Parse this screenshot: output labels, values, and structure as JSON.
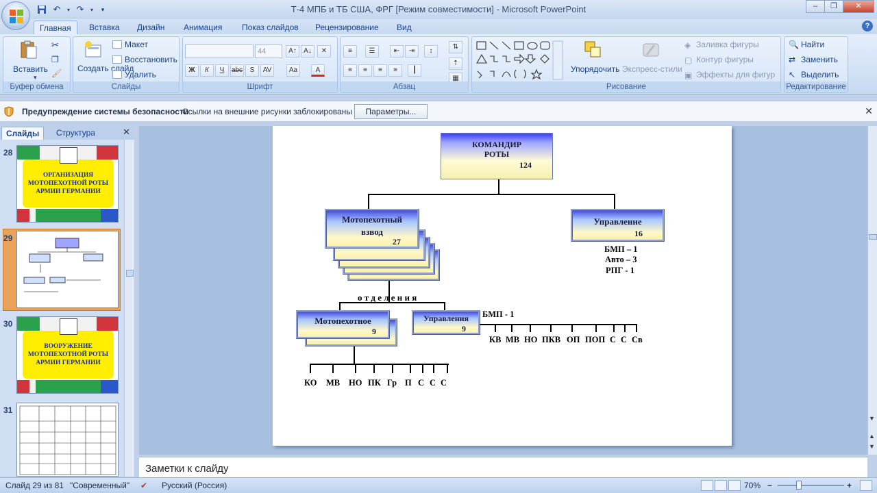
{
  "window": {
    "title": "Т-4 МПБ и ТБ США, ФРГ [Режим совместимости] - Microsoft PowerPoint"
  },
  "tabs": [
    {
      "label": "Главная"
    },
    {
      "label": "Вставка"
    },
    {
      "label": "Дизайн"
    },
    {
      "label": "Анимация"
    },
    {
      "label": "Показ слайдов"
    },
    {
      "label": "Рецензирование"
    },
    {
      "label": "Вид"
    }
  ],
  "ribbon": {
    "clipboard": {
      "label": "Буфер обмена",
      "paste": "Вставить"
    },
    "slides": {
      "label": "Слайды",
      "new_slide": "Создать слайд",
      "layout": "Макет",
      "reset": "Восстановить",
      "delete": "Удалить"
    },
    "font": {
      "label": "Шрифт",
      "font_size": "44"
    },
    "paragraph": {
      "label": "Абзац"
    },
    "drawing": {
      "label": "Рисование",
      "arrange": "Упорядочить",
      "quick_styles": "Экспресс-стили",
      "fill": "Заливка фигуры",
      "outline": "Контур фигуры",
      "effects": "Эффекты для фигур"
    },
    "editing": {
      "label": "Редактирование",
      "find": "Найти",
      "replace": "Заменить",
      "select": "Выделить"
    }
  },
  "security_bar": {
    "title": "Предупреждение системы безопасности",
    "message": "Ссылки на внешние рисунки заблокированы",
    "button": "Параметры..."
  },
  "pane": {
    "tab_slides": "Слайды",
    "tab_outline": "Структура",
    "thumbs": [
      {
        "num": "28",
        "text": "ОРГАНИЗАЦИЯ МОТОПЕХОТНОЙ РОТЫ АРМИИ ГЕРМАНИИ"
      },
      {
        "num": "29"
      },
      {
        "num": "30",
        "text": "ВООРУЖЕНИЕ МОТОПЕХОТНОЙ РОТЫ АРМИИ ГЕРМАНИИ"
      },
      {
        "num": "31"
      }
    ]
  },
  "slide": {
    "commander": {
      "line1": "КОМАНДИР",
      "line2": "РОТЫ",
      "count": "124"
    },
    "platoon": {
      "line1": "Мотопехотный",
      "line2": "взвод",
      "count": "27"
    },
    "management": {
      "label": "Управление",
      "count": "16"
    },
    "mgmt_equipment": [
      "БМП – 1",
      "Авто – 3",
      "РПГ - 1"
    ],
    "squads_label": "о т д е л е н и я",
    "squad": {
      "label": "Мотопехотное",
      "count": "9"
    },
    "squad_mgmt": {
      "label": "Управления",
      "count": "9"
    },
    "squad_mgmt_bmp": "БМП - 1",
    "squad_roles": [
      "КО",
      "МВ",
      "НО",
      "ПК",
      "Гр",
      "П",
      "С",
      "С",
      "С"
    ],
    "mgmt_roles": [
      "КВ",
      "МВ",
      "НО",
      "ПКВ",
      "ОП",
      "ПОП",
      "С",
      "С",
      "Св"
    ]
  },
  "notes": {
    "placeholder": "Заметки к слайду"
  },
  "status": {
    "slide_info": "Слайд 29 из 81",
    "theme": "\"Современный\"",
    "language": "Русский (Россия)",
    "zoom": "70%"
  }
}
